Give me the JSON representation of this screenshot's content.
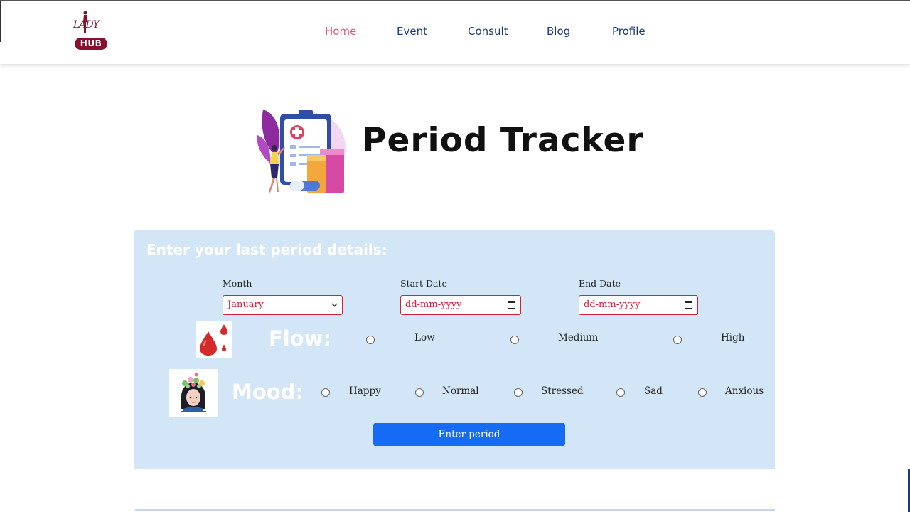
{
  "brand": {
    "logo_top": "LADY",
    "logo_bottom": "HUB"
  },
  "nav": [
    {
      "label": "Home",
      "active": true
    },
    {
      "label": "Event",
      "active": false
    },
    {
      "label": "Consult",
      "active": false
    },
    {
      "label": "Blog",
      "active": false
    },
    {
      "label": "Profile",
      "active": false
    }
  ],
  "page": {
    "title": "Period Tracker"
  },
  "form": {
    "heading": "Enter your last period details:",
    "month": {
      "label": "Month",
      "value": "January"
    },
    "start_date": {
      "label": "Start Date",
      "placeholder": "dd-mm-yyyy"
    },
    "end_date": {
      "label": "End Date",
      "placeholder": "dd-mm-yyyy"
    },
    "flow": {
      "label": "Flow:",
      "options": [
        "Low",
        "Medium",
        "High"
      ]
    },
    "mood": {
      "label": "Mood:",
      "options": [
        "Happy",
        "Normal",
        "Stressed",
        "Sad",
        "Anxious"
      ]
    },
    "submit_label": "Enter period"
  },
  "colors": {
    "accent": "#166bf5",
    "panel": "#d2e6f7",
    "nav_active": "#e05a7c",
    "nav": "#1d3a7a",
    "brand": "#8a1030",
    "field_border": "#d6203a"
  },
  "icons": {
    "hero": "clipboard-medical-illustration",
    "flow": "blood-drop-icon",
    "mood": "woman-flowers-icon",
    "calendar": "calendar-icon",
    "chevron": "chevron-down-icon"
  }
}
